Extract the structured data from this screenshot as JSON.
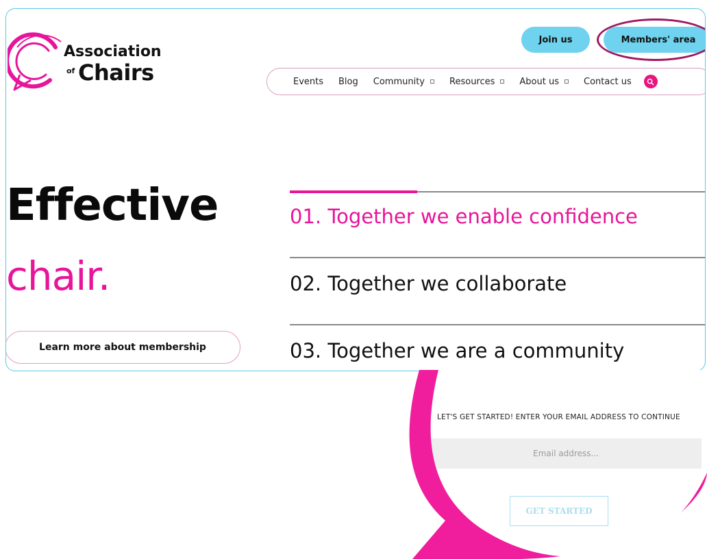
{
  "logo": {
    "line1": "Association",
    "of": "of",
    "line2": "Chairs",
    "icon": "speech-bubble-logo-icon"
  },
  "header": {
    "join_label": "Join us",
    "members_label": "Members' area"
  },
  "nav": {
    "items": [
      {
        "label": "Events",
        "dropdown": false
      },
      {
        "label": "Blog",
        "dropdown": false
      },
      {
        "label": "Community",
        "dropdown": true
      },
      {
        "label": "Resources",
        "dropdown": true
      },
      {
        "label": "About us",
        "dropdown": true
      },
      {
        "label": "Contact us",
        "dropdown": false
      }
    ],
    "search_icon": "search-icon"
  },
  "hero": {
    "line1": "Effective",
    "line2": "chair.",
    "cta_label": "Learn more about membership"
  },
  "steps": [
    {
      "label": "01. Together we enable confidence",
      "active": true
    },
    {
      "label": "02. Together we collaborate",
      "active": false
    },
    {
      "label": "03. Together we are a community",
      "active": false
    }
  ],
  "zoom": {
    "heading": "LET'S GET STARTED! ENTER YOUR EMAIL ADDRESS TO CONTINUE",
    "email_placeholder": "Email address...",
    "button_label": "GET STARTED"
  },
  "colors": {
    "accent_pink": "#e6159a",
    "accent_cyan": "#6fd2ee",
    "highlight_ring": "#a0175e"
  }
}
